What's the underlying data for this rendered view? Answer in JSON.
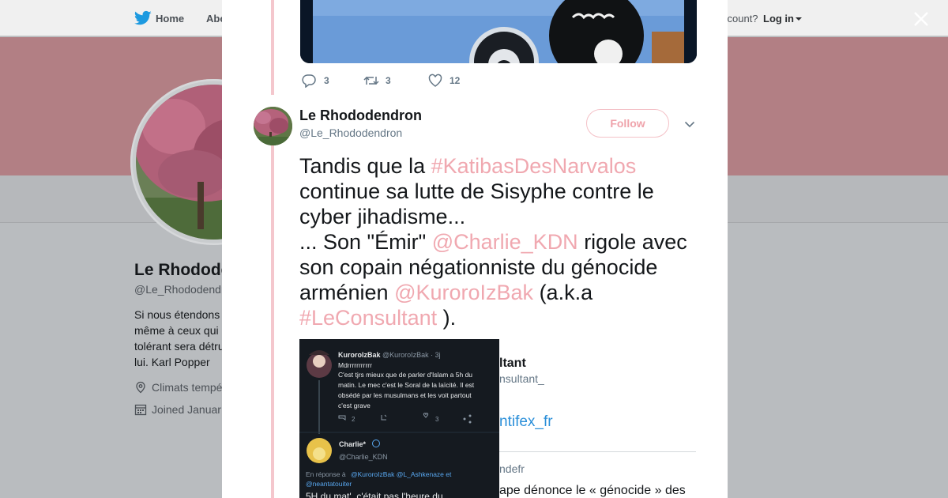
{
  "topnav": {
    "home_label": "Home",
    "about_label": "Abo",
    "account_text": "ccount?",
    "login_label": "Log in"
  },
  "profile": {
    "name": "Le Rhodode",
    "handle": "@Le_Rhododendr",
    "bio": "Si nous étendons\nmême à ceux qui\ntolérant sera détru\nlui. Karl Popper",
    "location": "Climats tempé",
    "joined": "Joined Januar"
  },
  "previous_tweet": {
    "reply_count": "3",
    "retweet_count": "3",
    "like_count": "12"
  },
  "tweet": {
    "name": "Le Rhododendron",
    "handle": "@Le_Rhododendron",
    "follow_label": "Follow",
    "text": {
      "t1": "Tandis que la ",
      "h1": "#KatibasDesNarvalos",
      "t2": " continue sa lutte de Sisyphe contre le cyber jihadisme...",
      "t3": "... Son \"Émir\" ",
      "m1": "@Charlie_KDN",
      "t4": " rigole avec son copain négationniste du génocide arménien ",
      "m2": "@KuroroIzBak",
      "t5": " (a.k.a ",
      "h2": "#LeConsultant",
      "t6": " )."
    }
  },
  "media_screenshot": {
    "tweet1": {
      "name": "KuroroIzBak",
      "meta": "@KuroroIzBak · 3j",
      "lines": [
        "Mdrrrrrrrrrrr",
        "C'est tjrs mieux que de parler d'Islam a 5h du",
        "matin. Le mec c'est le Soral de la laïcité. Il est",
        "obsédé par les musulmans et les voit partout",
        "c'est grave"
      ],
      "reply_count": "2",
      "like_count": "3"
    },
    "tweet2": {
      "name": "Charlie*",
      "handle": "@Charlie_KDN",
      "reply_prefix": "En réponse à ",
      "reply_to_1": "@KuroroIzBak @L_Ashkenaze et",
      "reply_to_2": "@neantatouiter",
      "body": "5H du mat'. c'était pas l'heure du"
    },
    "right": {
      "name_frag": "ltant",
      "handle_frag": "nsultant_",
      "link_frag": "ntifex_fr",
      "quoted_frag": "ndefr",
      "quoted_text": "ape dénonce le « génocide » des"
    }
  },
  "colors": {
    "link_pink": "#f0a8b0",
    "thread_line": "#f4c7cd",
    "banner": "#b27f84",
    "twitter_blue": "#1da1f2"
  }
}
